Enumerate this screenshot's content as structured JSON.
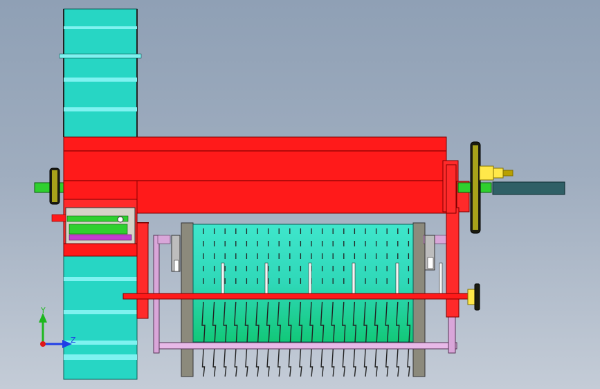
{
  "viewport": {
    "background_top": "#8fa0b5",
    "background_bottom": "#c4ccd7"
  },
  "colors": {
    "housing_red": "#ff1a1a",
    "housing_dark_red": "#c40000",
    "fan_cyan": "#27d6c4",
    "fan_light_cyan": "#7ff2f0",
    "drum_cyan": "#3fe6cc",
    "drum_green": "#12c878",
    "shaft_green": "#2fd02f",
    "pulley_yellow": "#f2e600",
    "motor_yellow": "#ffe84a",
    "belt_teal": "#2f5f66",
    "frame_pink": "#d9a6d9",
    "plate_grey": "#8c8a7c",
    "tooth_black": "#222222"
  },
  "triad": {
    "y_label": "Y",
    "z_label": "Z",
    "y_color": "#1db71d",
    "z_color": "#1f3ee6",
    "x_color": "#e01818"
  }
}
